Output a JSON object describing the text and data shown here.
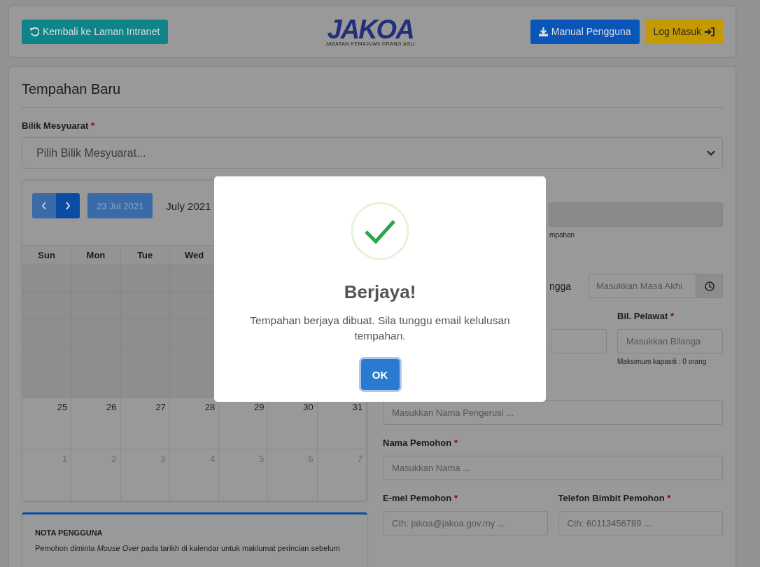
{
  "header": {
    "back_button": "Kembali ke Laman Intranet",
    "logo": {
      "text": "JAKOA",
      "subtitle": "JABATAN KEMAJUAN ORANG ASLI"
    },
    "manual_button": "Manual Pengguna",
    "login_button": "Log Masuk"
  },
  "form": {
    "title": "Tempahan Baru",
    "room_label": {
      "text": "Bilik Mesyuarat",
      "mark": "*"
    },
    "room_select": "Pilih Bilik Mesyuarat..."
  },
  "calendar": {
    "today_button": "23 Jul 2021",
    "today_disabled": true,
    "title": "July 2021",
    "weekdays": [
      "Sun",
      "Mon",
      "Tue",
      "Wed"
    ],
    "weeks": [
      {
        "days": [
          {
            "day": "25",
            "other_month": false
          },
          {
            "day": "26",
            "other_month": false
          },
          {
            "day": "27",
            "other_month": false
          },
          {
            "day": "28",
            "other_month": false
          },
          {
            "day": "29",
            "other_month": false
          },
          {
            "day": "30",
            "other_month": false
          },
          {
            "day": "31",
            "other_month": false
          }
        ]
      },
      {
        "days": [
          {
            "day": "1",
            "other_month": true
          },
          {
            "day": "2",
            "other_month": true
          },
          {
            "day": "3",
            "other_month": true
          },
          {
            "day": "4",
            "other_month": true
          },
          {
            "day": "5",
            "other_month": true
          },
          {
            "day": "6",
            "other_month": true
          },
          {
            "day": "7",
            "other_month": true
          }
        ]
      }
    ]
  },
  "note": {
    "title": "NOTA PENGGUNA",
    "text": "Pemohon diminta *Mouse Over* pada tarikh di kalendar untuk maklumat perincian sebelum"
  },
  "right": {
    "booking_field": {
      "disabled": true
    },
    "booking_hint": "mpahan",
    "end_time": {
      "label": "ngga",
      "placeholder": "Masukkan Masa Akhi"
    },
    "visitors": {
      "label": {
        "text": "Bil. Pelawat",
        "mark": "*"
      },
      "placeholder": "Masukkan Bilanga",
      "hint": "Maksimum kapasiti : 0 orang"
    },
    "chair": {
      "placeholder": "Masukkan Nama Pengerusi ..."
    },
    "name": {
      "label": {
        "text": "Nama Pemohon",
        "mark": "*"
      },
      "placeholder": "Masukkan Nama ..."
    },
    "email": {
      "label": {
        "text": "E-mel Pemohon",
        "mark": "*"
      },
      "placeholder": "Cth: jakoa@jakoa.gov.my ..."
    },
    "phone": {
      "label": {
        "text": "Telefon Bimbit Pemohon",
        "mark": "*"
      },
      "placeholder": "Cth: 60113456789 ..."
    }
  },
  "modal": {
    "kind": "success",
    "title": "Berjaya!",
    "message": "Tempahan berjaya dibuat. Sila tunggu email kelulusan tempahan.",
    "ok_button": "OK"
  }
}
